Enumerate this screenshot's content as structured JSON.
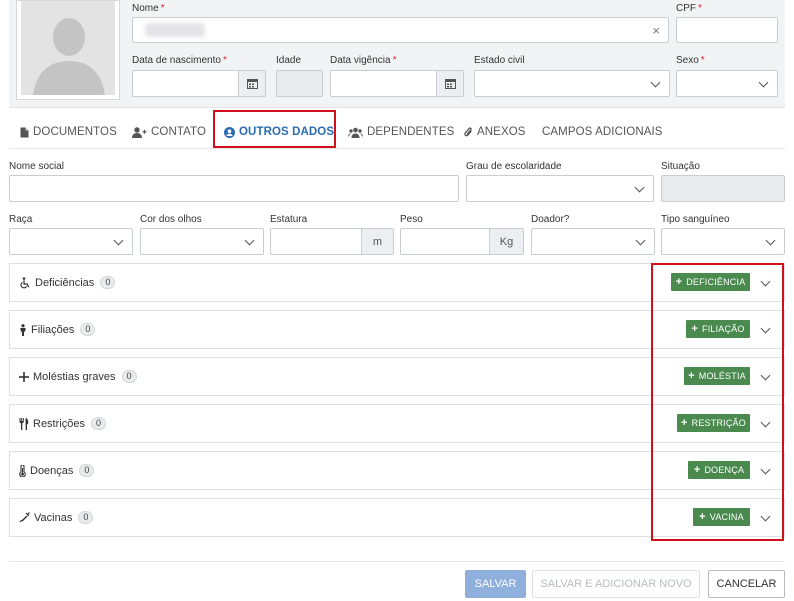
{
  "header": {
    "name_label": "Nome",
    "name_value": "",
    "cpf_label": "CPF",
    "cpf_value": "",
    "birth_label": "Data de nascimento",
    "birth_value": "",
    "age_label": "Idade",
    "age_value": "",
    "validity_label": "Data vigência",
    "validity_value": "",
    "marital_label": "Estado civil",
    "marital_value": "",
    "sex_label": "Sexo",
    "sex_value": "",
    "required_mark": "*",
    "clear_glyph": "×"
  },
  "tabs": [
    {
      "label": "DOCUMENTOS",
      "icon": "document-icon",
      "active": false
    },
    {
      "label": "CONTATO",
      "icon": "user-plus-icon",
      "active": false
    },
    {
      "label": "OUTROS DADOS",
      "icon": "user-circle-icon",
      "active": true
    },
    {
      "label": "DEPENDENTES",
      "icon": "users-icon",
      "active": false
    },
    {
      "label": "ANEXOS",
      "icon": "paperclip-icon",
      "active": false
    },
    {
      "label": "CAMPOS ADICIONAIS",
      "icon": "",
      "active": false
    }
  ],
  "form": {
    "social_name_label": "Nome social",
    "social_name_value": "",
    "education_label": "Grau de escolaridade",
    "education_value": "",
    "status_label": "Situação",
    "status_value": "",
    "race_label": "Raça",
    "race_value": "",
    "eye_label": "Cor dos olhos",
    "eye_value": "",
    "height_label": "Estatura",
    "height_value": "",
    "height_unit": "m",
    "weight_label": "Peso",
    "weight_value": "",
    "weight_unit": "Kg",
    "donor_label": "Doador?",
    "donor_value": "",
    "blood_label": "Tipo sanguíneo",
    "blood_value": ""
  },
  "panels": [
    {
      "title": "Deficiências",
      "count": "0",
      "button": "DEFICIÊNCIA",
      "icon": "wheelchair-icon"
    },
    {
      "title": "Filiações",
      "count": "0",
      "button": "FILIAÇÃO",
      "icon": "child-icon"
    },
    {
      "title": "Moléstias graves",
      "count": "0",
      "button": "MOLÉSTIA",
      "icon": "plus-icon"
    },
    {
      "title": "Restrições",
      "count": "0",
      "button": "RESTRIÇÃO",
      "icon": "cutlery-icon"
    },
    {
      "title": "Doenças",
      "count": "0",
      "button": "DOENÇA",
      "icon": "thermometer-icon"
    },
    {
      "title": "Vacinas",
      "count": "0",
      "button": "VACINA",
      "icon": "syringe-icon"
    }
  ],
  "footer": {
    "save": "SALVAR",
    "save_new": "SALVAR E ADICIONAR NOVO",
    "cancel": "CANCELAR"
  },
  "colors": {
    "accent": "#2a6cb3",
    "green_button": "#4a8a4f",
    "highlight_red": "#d0111b",
    "save_button": "#8fb0dc"
  }
}
